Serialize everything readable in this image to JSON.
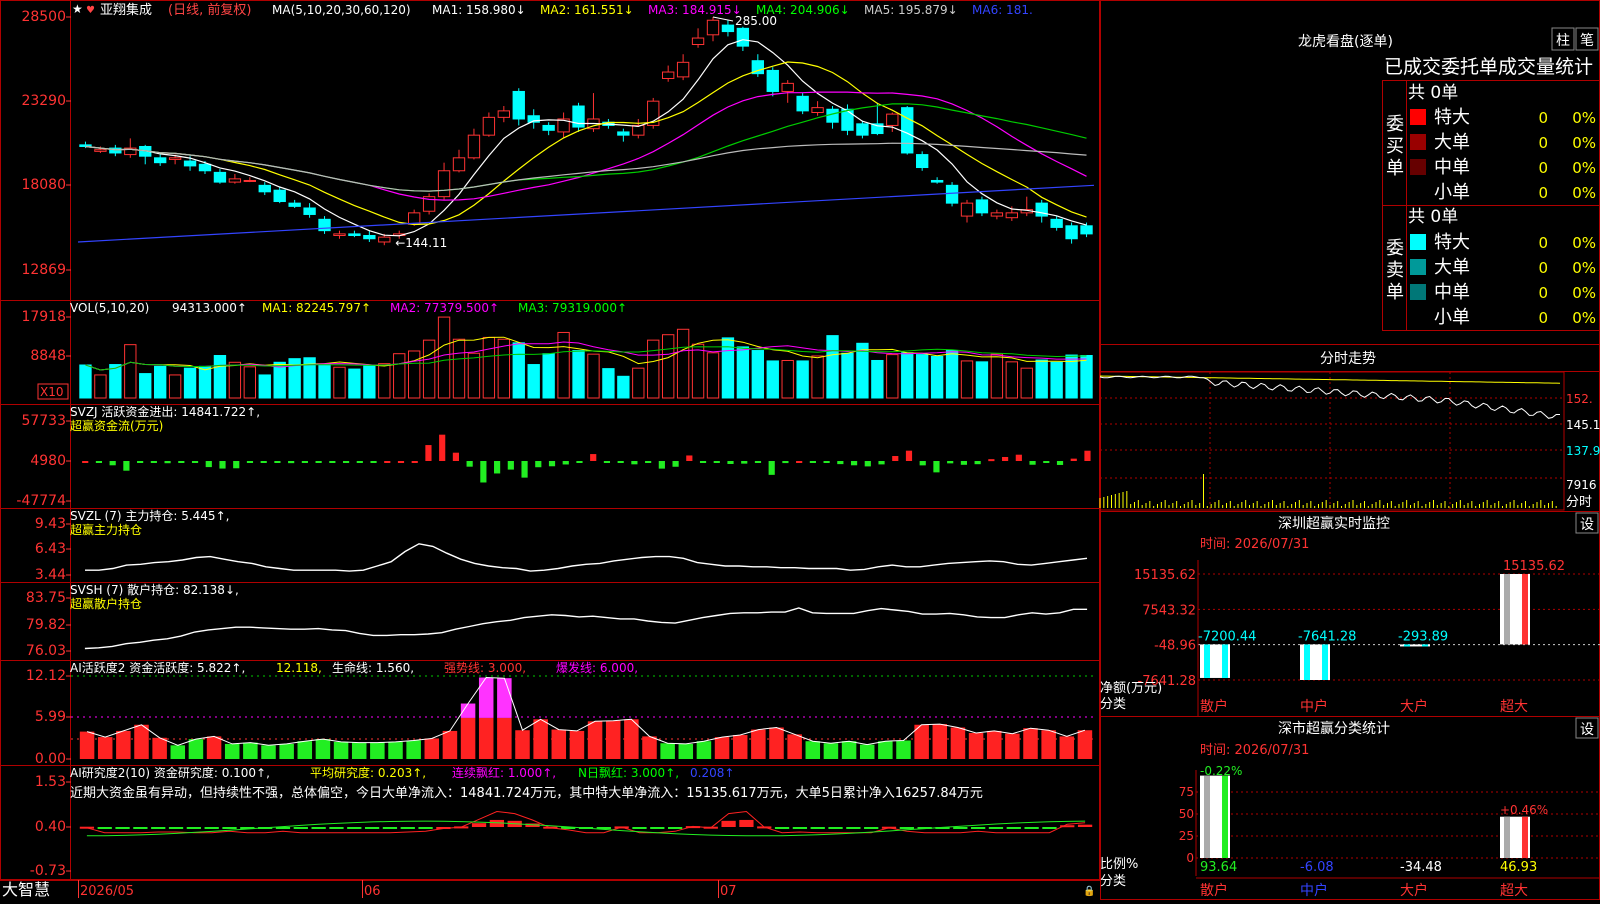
{
  "app": {
    "brand": "大智慧",
    "bottom_axis": [
      "2026/05",
      "06",
      "07"
    ]
  },
  "main": {
    "star": "★",
    "stock_name": "亚翔集成",
    "period": "(日线, 前复权)",
    "ma_spec": "MA(5,10,20,30,60,120)",
    "ma_values": [
      {
        "label": "MA1: 158.980↓",
        "color": "#ffffff"
      },
      {
        "label": "MA2: 161.551↓",
        "color": "#ffff00"
      },
      {
        "label": "MA3: 184.915↓",
        "color": "#ff00ff"
      },
      {
        "label": "MA4: 204.906↓",
        "color": "#00ff00"
      },
      {
        "label": "MA5: 195.879↓",
        "color": "#cccccc"
      },
      {
        "label": "MA6: 181.",
        "color": "#3344ff"
      }
    ],
    "y_ticks": [
      "28500",
      "23290",
      "18080",
      "12869"
    ],
    "high_label": "285.00",
    "low_label": "144.11"
  },
  "vol": {
    "title": "VOL(5,10,20)",
    "value": "94313.000↑",
    "ma": [
      {
        "label": "MA1: 82245.797↑",
        "color": "#ffff00"
      },
      {
        "label": "MA2: 77379.500↑",
        "color": "#ff00ff"
      },
      {
        "label": "MA3: 79319.000↑",
        "color": "#00ff00"
      }
    ],
    "y_ticks": [
      "17918",
      "8848"
    ],
    "unit": "X10"
  },
  "svzj": {
    "title": "SVZJ  活跃资金进出: 14841.722↑,",
    "subtitle": "超赢资金流(万元)",
    "y_ticks": [
      "57733",
      "4980",
      "-47774"
    ]
  },
  "svzl": {
    "title": "SVZL (7) 主力持仓: 5.445↑,",
    "subtitle": "超赢主力持仓",
    "y_ticks": [
      "9.43",
      "6.43",
      "3.44"
    ]
  },
  "svsh": {
    "title": "SVSH (7) 散户持仓: 82.138↓,",
    "subtitle": "超赢散户持仓",
    "y_ticks": [
      "83.75",
      "79.82",
      "76.03"
    ]
  },
  "ai1": {
    "parts": [
      {
        "t": "AI活跃度2 资金活跃度: 5.822↑,",
        "c": "#ffffff"
      },
      {
        "t": "12.118,",
        "c": "#ffff00"
      },
      {
        "t": " 生命线: 1.560,",
        "c": "#ffffff"
      },
      {
        "t": " 强势线: 3.000,",
        "c": "#ff3333"
      },
      {
        "t": " 爆发线: 6.000,",
        "c": "#ff00ff"
      }
    ],
    "y_ticks": [
      "12.12",
      "5.99",
      "0.00"
    ]
  },
  "ai2": {
    "parts": [
      {
        "t": "AI研究度2(10) 资金研究度: 0.100↑,",
        "c": "#ffffff"
      },
      {
        "t": " 平均研究度: 0.203↑,",
        "c": "#ffff00"
      },
      {
        "t": " 连续飘红: 1.000↑,",
        "c": "#ff00ff"
      },
      {
        "t": " N日飘红: 3.000↑,",
        "c": "#00ff00"
      },
      {
        "t": " 0.208↑",
        "c": "#3344ff"
      }
    ],
    "note": "近期大资金虽有异动，但持续性不强，总体偏空，今日大单净流入：14841.724万元，其中特大单净流入：15135.617万元，大单5日累计净入16257.84万元",
    "y_ticks": [
      "1.53",
      "0.40",
      "-0.73"
    ]
  },
  "right": {
    "lhkp_title": "龙虎看盘(逐单)",
    "btn_zhu": "柱",
    "btn_bi": "笔",
    "table_title": "已成交委托单成交量统计",
    "buy_label": "委买单",
    "sell_label": "委卖单",
    "buy_total": "共 0单",
    "sell_total": "共 0单",
    "buy_rows": [
      {
        "name": "特大",
        "count": "0",
        "pct": "0%",
        "color": "#ff0000"
      },
      {
        "name": "大单",
        "count": "0",
        "pct": "0%",
        "color": "#990000"
      },
      {
        "name": "中单",
        "count": "0",
        "pct": "0%",
        "color": "#660000"
      },
      {
        "name": "小单",
        "count": "0",
        "pct": "0%",
        "color": ""
      }
    ],
    "sell_rows": [
      {
        "name": "特大",
        "count": "0",
        "pct": "0%",
        "color": "#00ffff"
      },
      {
        "name": "大单",
        "count": "0",
        "pct": "0%",
        "color": "#009999"
      },
      {
        "name": "中单",
        "count": "0",
        "pct": "0%",
        "color": "#007777"
      },
      {
        "name": "小单",
        "count": "0",
        "pct": "0%",
        "color": ""
      }
    ],
    "fs_title": "分时走势",
    "fs_ticks": [
      "152.",
      "145.1",
      "137.9"
    ],
    "fs_vol_label": "7916",
    "fs_vol_unit": "分时",
    "monitor_title": "深圳超赢实时监控",
    "setting_btn": "设",
    "time_label": "时间: 2026/07/31",
    "monitor_y_ticks": [
      "15135.62",
      "7543.32",
      "-48.96",
      "-7641.28"
    ],
    "monitor_values": [
      "-7200.44",
      "-7641.28",
      "-293.89",
      "15135.62"
    ],
    "categories": [
      "散户",
      "中户",
      "大户",
      "超大"
    ],
    "net_label": "净额(万元)",
    "cat_label": "分类",
    "stat_title": "深市超赢分类统计",
    "stat_time": "时间: 2026/07/31",
    "stat_ticks": [
      "75",
      "50",
      "25",
      "0"
    ],
    "stat_top": [
      "-0.22%",
      "+0.46%"
    ],
    "stat_bottom": [
      "93.64",
      "-6.08",
      "-34.48",
      "46.93"
    ],
    "ratio_label": "比例%"
  },
  "chart_data": [
    {
      "type": "candlestick",
      "title": "亚翔集成 (日线, 前复权)",
      "ylim": [
        128.69,
        285.0
      ],
      "candles": [
        [
          206,
          205,
          208,
          204
        ],
        [
          202,
          203,
          205,
          201
        ],
        [
          204,
          201,
          206,
          199
        ],
        [
          200,
          204,
          210,
          198
        ],
        [
          205,
          199,
          206,
          194
        ],
        [
          198,
          195,
          200,
          193
        ],
        [
          197,
          198,
          200,
          194
        ],
        [
          196,
          193,
          199,
          190
        ],
        [
          194,
          190,
          196,
          188
        ],
        [
          189,
          183,
          191,
          182
        ],
        [
          183,
          185,
          188,
          182
        ],
        [
          184,
          184,
          186,
          183
        ],
        [
          181,
          177,
          183,
          175
        ],
        [
          178,
          171,
          180,
          170
        ],
        [
          170,
          168,
          172,
          167
        ],
        [
          167,
          163,
          170,
          161
        ],
        [
          160,
          153,
          162,
          151
        ],
        [
          150,
          151,
          153,
          148
        ],
        [
          151,
          150,
          153,
          149
        ],
        [
          150,
          148,
          153,
          146
        ],
        [
          146,
          149,
          151,
          144
        ],
        [
          150,
          151,
          153,
          148
        ],
        [
          157,
          164,
          166,
          156
        ],
        [
          165,
          174,
          176,
          163
        ],
        [
          174,
          190,
          195,
          172
        ],
        [
          190,
          198,
          203,
          189
        ],
        [
          198,
          212,
          216,
          197
        ],
        [
          212,
          223,
          226,
          211
        ],
        [
          223,
          227,
          230,
          220
        ],
        [
          239,
          222,
          241,
          218
        ],
        [
          224,
          220,
          228,
          216
        ],
        [
          218,
          215,
          220,
          212
        ],
        [
          214,
          222,
          226,
          210
        ],
        [
          230,
          217,
          232,
          214
        ],
        [
          216,
          222,
          238,
          214
        ],
        [
          220,
          218,
          222,
          216
        ],
        [
          214,
          212,
          216,
          208
        ],
        [
          212,
          218,
          222,
          210
        ],
        [
          218,
          233,
          235,
          216
        ],
        [
          247,
          251,
          255,
          245
        ],
        [
          248,
          257,
          262,
          246
        ],
        [
          268,
          272,
          278,
          266
        ],
        [
          274,
          283,
          285,
          270
        ],
        [
          280,
          276,
          283,
          273
        ],
        [
          278,
          267,
          279,
          264
        ],
        [
          258,
          250,
          262,
          248
        ],
        [
          252,
          239,
          254,
          236
        ],
        [
          239,
          244,
          246,
          232
        ],
        [
          236,
          227,
          238,
          225
        ],
        [
          226,
          229,
          233,
          224
        ],
        [
          228,
          220,
          230,
          216
        ],
        [
          228,
          215,
          231,
          212
        ],
        [
          219,
          212,
          221,
          210
        ],
        [
          219,
          213,
          232,
          212
        ],
        [
          218,
          225,
          226,
          214
        ],
        [
          229,
          201,
          230,
          200
        ],
        [
          200,
          192,
          202,
          190
        ],
        [
          184,
          183,
          186,
          182
        ],
        [
          181,
          170,
          183,
          168
        ],
        [
          162,
          170,
          172,
          158
        ],
        [
          172,
          164,
          174,
          162
        ],
        [
          162,
          164,
          166,
          160
        ],
        [
          161,
          164,
          168,
          159
        ],
        [
          164,
          166,
          174,
          162
        ],
        [
          170,
          162,
          172,
          158
        ],
        [
          160,
          155,
          162,
          153
        ],
        [
          156,
          148,
          158,
          145
        ],
        [
          156,
          151,
          158,
          149
        ]
      ],
      "annotations": [
        "285.00",
        "144.11"
      ]
    },
    {
      "type": "bar",
      "title": "VOL(5,10,20)",
      "unit": "X10",
      "ylim": [
        0,
        17918
      ],
      "values": [
        7300,
        5100,
        7400,
        11800,
        5400,
        7000,
        5100,
        6600,
        7000,
        9400,
        7900,
        6900,
        5100,
        7900,
        8700,
        8900,
        7500,
        6800,
        6400,
        7100,
        7600,
        9800,
        10400,
        12800,
        17900,
        13000,
        9900,
        13400,
        13000,
        12200,
        7400,
        9800,
        14500,
        10500,
        9700,
        6500,
        4800,
        6600,
        12800,
        14000,
        15200,
        11900,
        10000,
        13300,
        11300,
        10500,
        8200,
        8300,
        8200,
        9300,
        13800,
        9900,
        12100,
        8300,
        9600,
        10000,
        9600,
        9200,
        10500,
        8200,
        8000,
        9700,
        8000,
        6600,
        8400,
        7900,
        9500,
        9400
      ]
    },
    {
      "type": "bar",
      "title": "超赢资金流(万元)",
      "ylim": [
        -47774,
        57733
      ],
      "values": [
        0,
        -800,
        -6200,
        -14000,
        -1200,
        -2300,
        -3200,
        -1000,
        -2800,
        -8800,
        -10900,
        -10500,
        -2200,
        -1200,
        -1900,
        -3100,
        -2400,
        -2400,
        -1100,
        -1900,
        -900,
        -1100,
        0,
        0,
        0,
        23000,
        38000,
        12000,
        -8200,
        -31000,
        -18000,
        -12400,
        -24000,
        -9000,
        -7600,
        -5000,
        -900,
        10000,
        -500,
        -1500,
        -4800,
        -2300,
        -11000,
        -8300,
        8000,
        -1700,
        -2400,
        -4300,
        -3800,
        -900,
        -20000,
        -3000,
        0,
        -1500,
        -2600,
        -4500,
        -6200,
        -7800,
        -4900,
        7200,
        14900,
        -6300,
        -16400,
        -3400,
        -5500,
        -4600,
        2700,
        5800,
        9100,
        -5400,
        -1500,
        -5700,
        3400,
        14841
      ]
    },
    {
      "type": "line",
      "title": "超赢主力持仓",
      "ylim": [
        3.44,
        9.43
      ],
      "values": [
        4.0,
        4.0,
        4.2,
        4.6,
        4.7,
        4.9,
        5.0,
        5.2,
        5.5,
        5.6,
        5.3,
        5.0,
        4.8,
        4.4,
        4.2,
        4.0,
        4.0,
        4.0,
        4.0,
        3.9,
        4.0,
        4.5,
        5.0,
        6.2,
        7.1,
        6.8,
        6.0,
        5.3,
        4.8,
        4.5,
        4.3,
        4.2,
        3.9,
        4.0,
        4.2,
        4.5,
        4.7,
        4.8,
        5.1,
        5.3,
        5.5,
        5.6,
        5.6,
        5.4,
        4.9,
        4.7,
        4.5,
        4.5,
        4.4,
        4.4,
        4.3,
        4.3,
        4.2,
        4.2,
        4.2,
        4.0,
        4.1,
        4.4,
        4.6,
        4.4,
        4.4,
        4.6,
        4.8,
        4.9,
        5.0,
        5.1,
        5.0,
        4.7,
        4.6,
        4.8,
        5.0,
        5.2,
        5.4
      ]
    },
    {
      "type": "line",
      "title": "超赢散户持仓",
      "ylim": [
        76.03,
        83.75
      ],
      "values": [
        76.4,
        76.5,
        76.7,
        77.1,
        77.3,
        77.6,
        77.8,
        78.2,
        78.8,
        79.1,
        79.3,
        79.5,
        79.5,
        79.4,
        79.3,
        79.2,
        79.2,
        79.3,
        79.1,
        79.0,
        78.6,
        78.3,
        78.3,
        78.4,
        78.4,
        78.5,
        78.7,
        79.2,
        79.6,
        80.0,
        80.3,
        80.5,
        80.9,
        81.1,
        81.3,
        81.2,
        81.0,
        81.1,
        80.9,
        80.7,
        80.7,
        80.4,
        80.2,
        80.1,
        80.5,
        80.9,
        81.2,
        81.5,
        81.6,
        81.6,
        81.7,
        81.7,
        82.3,
        81.6,
        81.5,
        81.5,
        81.5,
        81.9,
        82.2,
        82.0,
        81.8,
        81.4,
        81.4,
        81.5,
        81.3,
        81.0,
        80.9,
        80.9,
        81.3,
        81.6,
        81.4,
        81.6,
        82.1,
        82.1
      ]
    },
    {
      "type": "bar",
      "title": "AI活跃度2",
      "ylim": [
        0,
        12.12
      ],
      "values": [
        4.0,
        3.2,
        4.1,
        5.0,
        3.1,
        2.0,
        2.9,
        3.3,
        2.2,
        2.4,
        2.0,
        2.2,
        2.6,
        2.9,
        2.5,
        2.4,
        2.4,
        2.5,
        2.7,
        3.0,
        4.1,
        8.1,
        11.9,
        11.8,
        4.2,
        5.8,
        4.3,
        4.1,
        5.5,
        5.6,
        5.8,
        3.3,
        2.3,
        2.2,
        2.6,
        3.2,
        3.5,
        4.3,
        4.6,
        3.6,
        2.6,
        2.3,
        2.6,
        2.1,
        2.6,
        2.7,
        5.0,
        5.1,
        4.6,
        3.8,
        4.1,
        3.7,
        4.5,
        4.2,
        3.3,
        4.2
      ],
      "lines": [
        "生命线: 1.560",
        "强势线: 3.000",
        "爆发线: 6.000"
      ]
    },
    {
      "type": "bar",
      "title": "AI研究度2(10)",
      "ylim": [
        -0.73,
        1.53
      ],
      "values": [
        0.01,
        -0.06,
        -0.06,
        -0.06,
        -0.05,
        -0.05,
        -0.06,
        -0.06,
        -0.04,
        -0.06,
        -0.06,
        -0.04,
        -0.06,
        -0.06,
        -0.06,
        -0.06,
        -0.06,
        -0.06,
        -0.05,
        -0.04,
        0.0,
        0.02,
        0.13,
        0.24,
        0.21,
        0.12,
        0.01,
        -0.02,
        -0.06,
        -0.06,
        0.02,
        -0.06,
        -0.06,
        -0.04,
        0.03,
        0.01,
        0.21,
        0.24,
        0.02,
        -0.06,
        -0.05,
        -0.06,
        -0.06,
        -0.06,
        -0.06,
        0.01,
        -0.04,
        -0.06,
        -0.06,
        -0.06,
        -0.04,
        -0.06,
        -0.06,
        -0.06,
        -0.06,
        0.06,
        0.08
      ]
    },
    {
      "type": "bar",
      "title": "深圳超赢实时监控",
      "categories": [
        "散户",
        "中户",
        "大户",
        "超大"
      ],
      "values": [
        -7200.44,
        -7641.28,
        -293.89,
        15135.62
      ],
      "ylim": [
        -7641.28,
        15135.62
      ]
    },
    {
      "type": "bar",
      "title": "深市超赢分类统计",
      "categories": [
        "散户",
        "中户",
        "大户",
        "超大"
      ],
      "values": [
        93.64,
        -6.08,
        -34.48,
        46.93
      ],
      "ylim": [
        0,
        75
      ]
    }
  ]
}
